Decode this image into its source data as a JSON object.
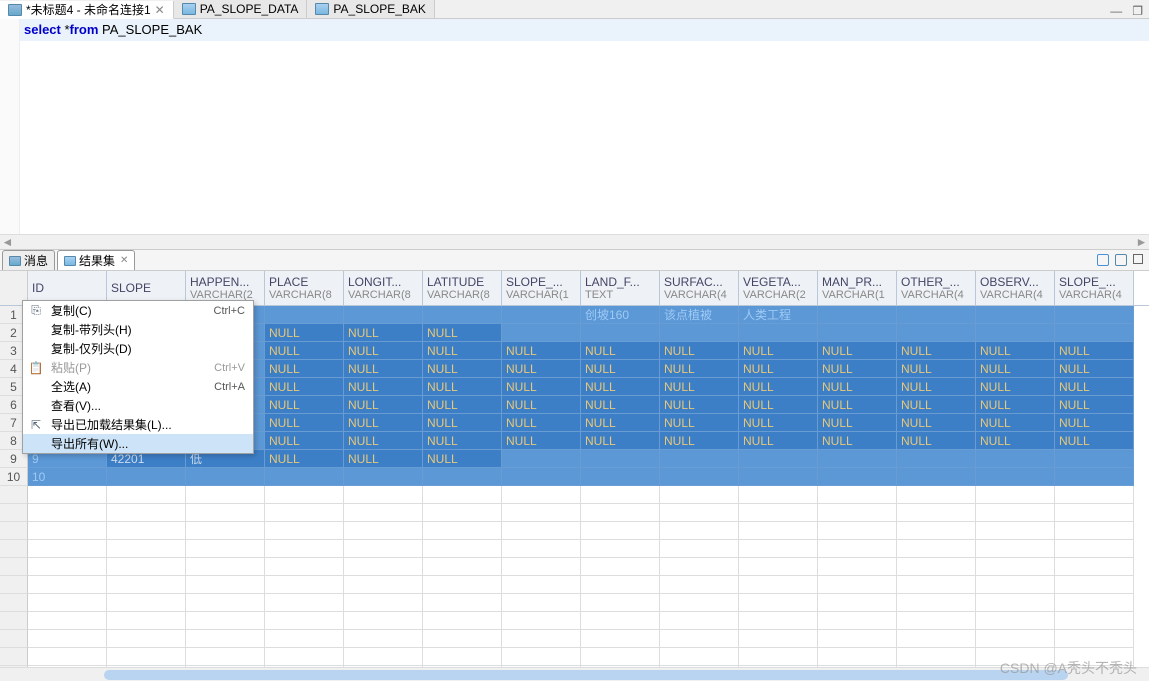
{
  "editor_tabs": [
    {
      "label": "*未标题4 - 未命名连接1",
      "active": true,
      "closable": true
    },
    {
      "label": "PA_SLOPE_DATA",
      "active": false
    },
    {
      "label": "PA_SLOPE_BAK",
      "active": false
    }
  ],
  "sql": {
    "kw1": "select",
    "star": " *",
    "kw2": "from",
    "rest": " PA_SLOPE_BAK"
  },
  "result_tabs": {
    "msg": "消息",
    "result": "结果集",
    "close_glyph": "✕"
  },
  "columns": [
    {
      "name": "ID",
      "type": ""
    },
    {
      "name": "SLOPE",
      "type": ""
    },
    {
      "name": "HAPPEN...",
      "type": "VARCHAR(2"
    },
    {
      "name": "PLACE",
      "type": "VARCHAR(8"
    },
    {
      "name": "LONGIT...",
      "type": "VARCHAR(8"
    },
    {
      "name": "LATITUDE",
      "type": "VARCHAR(8"
    },
    {
      "name": "SLOPE_...",
      "type": "VARCHAR(1"
    },
    {
      "name": "LAND_F...",
      "type": "TEXT"
    },
    {
      "name": "SURFAC...",
      "type": "VARCHAR(4"
    },
    {
      "name": "VEGETA...",
      "type": "VARCHAR(2"
    },
    {
      "name": "MAN_PR...",
      "type": "VARCHAR(1"
    },
    {
      "name": "OTHER_...",
      "type": "VARCHAR(4"
    },
    {
      "name": "OBSERV...",
      "type": "VARCHAR(4"
    },
    {
      "name": "SLOPE_...",
      "type": "VARCHAR(4"
    }
  ],
  "row_data": {
    "r1": {
      "c7": "创坡160",
      "c8": "该点植被",
      "c9": "人类工程"
    },
    "r9_c1": "42201",
    "r9_c2": "低"
  },
  "rows": [
    [
      "1",
      "",
      "",
      "",
      "",
      "",
      "",
      "",
      "",
      "",
      "",
      "",
      "",
      ""
    ],
    [
      "2",
      "",
      "",
      "NULL",
      "NULL",
      "NULL",
      "",
      "",
      "",
      "",
      "",
      "",
      "",
      ""
    ],
    [
      "3",
      "",
      "",
      "NULL",
      "NULL",
      "NULL",
      "NULL",
      "NULL",
      "NULL",
      "NULL",
      "NULL",
      "NULL",
      "NULL",
      "NULL"
    ],
    [
      "4",
      "",
      "",
      "NULL",
      "NULL",
      "NULL",
      "NULL",
      "NULL",
      "NULL",
      "NULL",
      "NULL",
      "NULL",
      "NULL",
      "NULL"
    ],
    [
      "5",
      "",
      "",
      "NULL",
      "NULL",
      "NULL",
      "NULL",
      "NULL",
      "NULL",
      "NULL",
      "NULL",
      "NULL",
      "NULL",
      "NULL"
    ],
    [
      "6",
      "",
      "",
      "NULL",
      "NULL",
      "NULL",
      "NULL",
      "NULL",
      "NULL",
      "NULL",
      "NULL",
      "NULL",
      "NULL",
      "NULL"
    ],
    [
      "7",
      "",
      "",
      "NULL",
      "NULL",
      "NULL",
      "NULL",
      "NULL",
      "NULL",
      "NULL",
      "NULL",
      "NULL",
      "NULL",
      "NULL"
    ],
    [
      "8",
      "",
      "",
      "NULL",
      "NULL",
      "NULL",
      "NULL",
      "NULL",
      "NULL",
      "NULL",
      "NULL",
      "NULL",
      "NULL",
      "NULL"
    ],
    [
      "9",
      "",
      "",
      "NULL",
      "NULL",
      "NULL",
      "",
      "",
      "",
      "",
      "",
      "",
      "",
      ""
    ],
    [
      "10",
      "",
      "",
      "",
      "",
      "",
      "",
      "",
      "",
      "",
      "",
      "",
      "",
      ""
    ]
  ],
  "null_label": "NULL",
  "row_nums": [
    "1",
    "2",
    "3",
    "4",
    "5",
    "6",
    "7",
    "8",
    "9",
    "10"
  ],
  "context_menu": [
    {
      "icon": "copy-icon",
      "label": "复制(C)",
      "shortcut": "Ctrl+C"
    },
    {
      "icon": "",
      "label": "复制-带列头(H)",
      "shortcut": ""
    },
    {
      "icon": "",
      "label": "复制-仅列头(D)",
      "shortcut": ""
    },
    {
      "icon": "paste-icon",
      "label": "粘贴(P)",
      "shortcut": "Ctrl+V",
      "disabled": true
    },
    {
      "icon": "",
      "label": "全选(A)",
      "shortcut": "Ctrl+A"
    },
    {
      "icon": "",
      "label": "查看(V)...",
      "shortcut": ""
    },
    {
      "icon": "export-icon",
      "label": "导出已加载结果集(L)...",
      "shortcut": ""
    },
    {
      "icon": "",
      "label": "导出所有(W)...",
      "shortcut": "",
      "hover": true
    }
  ],
  "window_controls": {
    "min": "—",
    "max": "❐"
  },
  "watermark": "CSDN @A秃头不秃头",
  "scroll_arrows": {
    "left": "◄",
    "right": "►"
  }
}
